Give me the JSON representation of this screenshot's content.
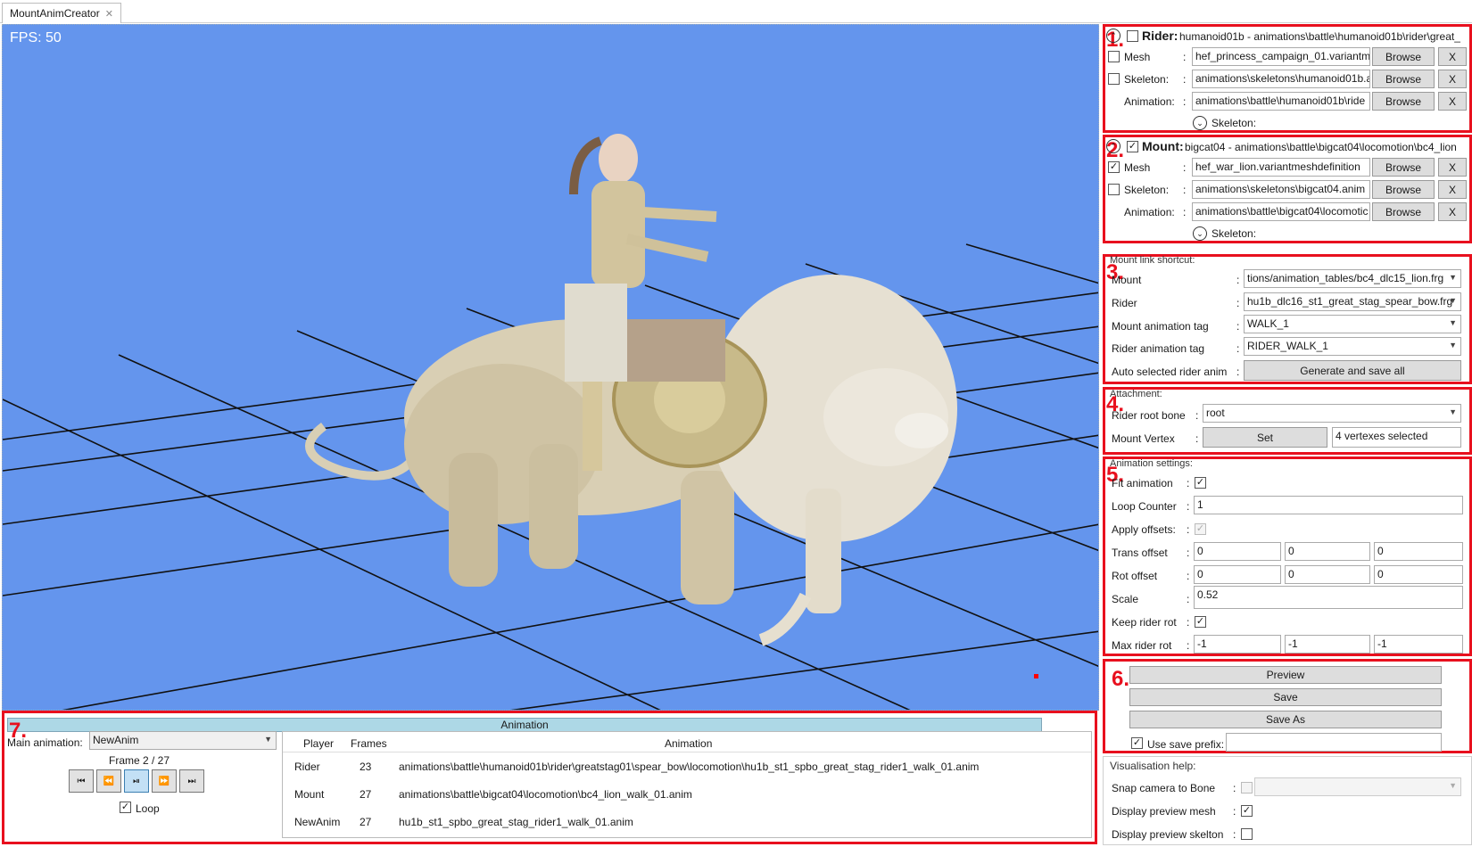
{
  "tab": {
    "title": "MountAnimCreator"
  },
  "viewport": {
    "fps": "FPS: 50",
    "background": "#6495ed"
  },
  "annotations": {
    "n1": "1.",
    "n2": "2.",
    "n3": "3.",
    "n4": "4.",
    "n5": "5.",
    "n6": "6.",
    "n7": "7."
  },
  "rider": {
    "heading": "Rider:",
    "summary": "humanoid01b - animations\\battle\\humanoid01b\\rider\\great_",
    "mesh_label": "Mesh",
    "mesh_value": "hef_princess_campaign_01.variantmes",
    "skeleton_label": "Skeleton:",
    "skeleton_value": "animations\\skeletons\\humanoid01b.a",
    "animation_label": "Animation:",
    "animation_value": "animations\\battle\\humanoid01b\\ride",
    "skeleton_toggle": "Skeleton:"
  },
  "mount": {
    "heading": "Mount:",
    "summary": "bigcat04 - animations\\battle\\bigcat04\\locomotion\\bc4_lion",
    "mesh_label": "Mesh",
    "mesh_value": "hef_war_lion.variantmeshdefinition",
    "skeleton_label": "Skeleton:",
    "skeleton_value": "animations\\skeletons\\bigcat04.anim",
    "animation_label": "Animation:",
    "animation_value": "animations\\battle\\bigcat04\\locomotic",
    "skeleton_toggle": "Skeleton:"
  },
  "common": {
    "browse": "Browse",
    "clear": "X",
    "colon": ":"
  },
  "mount_link": {
    "title": "Mount link shortcut:",
    "mount_label": "Mount",
    "mount_value": "tions/animation_tables/bc4_dlc15_lion.frg",
    "rider_label": "Rider",
    "rider_value": "hu1b_dlc16_st1_great_stag_spear_bow.frg",
    "mount_tag_label": "Mount animation tag",
    "mount_tag_value": "WALK_1",
    "rider_tag_label": "Rider animation tag",
    "rider_tag_value": "RIDER_WALK_1",
    "auto_label": "Auto selected rider anim",
    "generate_button": "Generate and save all"
  },
  "attachment": {
    "title": "Attachment:",
    "root_bone_label": "Rider root bone",
    "root_bone_value": "root",
    "vertex_label": "Mount Vertex",
    "set_button": "Set",
    "vertex_status": "4 vertexes selected"
  },
  "anim_settings": {
    "title": "Animation settings:",
    "fit_label": "Fit animation",
    "loop_label": "Loop Counter",
    "loop_value": "1",
    "offsets_label": "Apply offsets:",
    "trans_label": "Trans offset",
    "trans": [
      "0",
      "0",
      "0"
    ],
    "rot_label": "Rot offset",
    "rot": [
      "0",
      "0",
      "0"
    ],
    "scale_label": "Scale",
    "scale_value": "0.52",
    "keep_label": "Keep rider rot",
    "max_label": "Max rider rot",
    "max": [
      "-1",
      "-1",
      "-1"
    ]
  },
  "save": {
    "preview": "Preview",
    "save": "Save",
    "save_as": "Save As",
    "prefix_label": "Use save prefix:"
  },
  "vis": {
    "title": "Visualisation help:",
    "snap_label": "Snap camera to Bone",
    "mesh_label": "Display preview mesh",
    "skel_label": "Display preview skelton"
  },
  "bottom": {
    "header": "Animation",
    "main_label": "Main animation:",
    "main_value": "NewAnim",
    "frame": "Frame 2 / 27",
    "loop_label": "Loop",
    "columns": [
      "Player",
      "Frames",
      "Animation"
    ],
    "rows": [
      {
        "player": "Rider",
        "frames": "23",
        "anim": "animations\\battle\\humanoid01b\\rider\\greatstag01\\spear_bow\\locomotion\\hu1b_st1_spbo_great_stag_rider1_walk_01.anim"
      },
      {
        "player": "Mount",
        "frames": "27",
        "anim": "animations\\battle\\bigcat04\\locomotion\\bc4_lion_walk_01.anim"
      },
      {
        "player": "NewAnim",
        "frames": "27",
        "anim": "hu1b_st1_spbo_great_stag_rider1_walk_01.anim"
      }
    ]
  }
}
